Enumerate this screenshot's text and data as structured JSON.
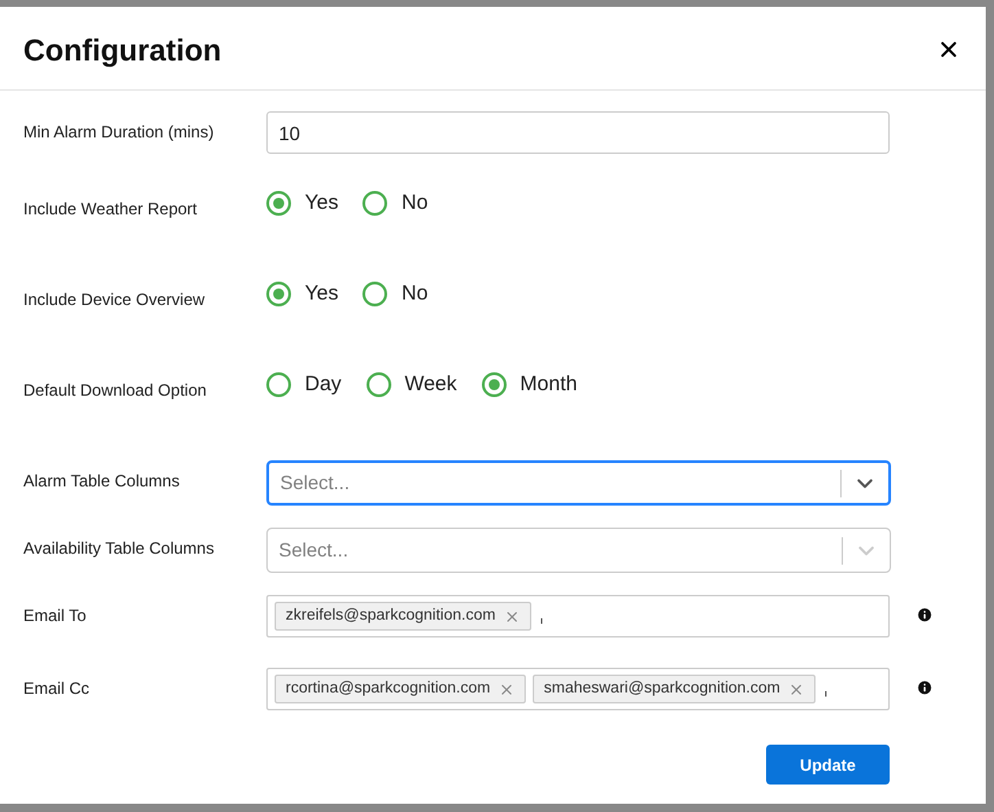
{
  "dialog": {
    "title": "Configuration"
  },
  "fields": [
    {
      "kind": "text",
      "label": "Min Alarm Duration (mins)",
      "value": "10"
    },
    {
      "kind": "radio",
      "label": "Include Weather Report",
      "options": [
        {
          "label": "Yes",
          "selected": true
        },
        {
          "label": "No",
          "selected": false
        }
      ]
    },
    {
      "kind": "radio",
      "label": "Include Device Overview",
      "options": [
        {
          "label": "Yes",
          "selected": true
        },
        {
          "label": "No",
          "selected": false
        }
      ]
    },
    {
      "kind": "radio",
      "label": "Default Download Option",
      "options": [
        {
          "label": "Day",
          "selected": false
        },
        {
          "label": "Week",
          "selected": false
        },
        {
          "label": "Month",
          "selected": true
        }
      ]
    },
    {
      "kind": "select",
      "label": "Alarm Table Columns",
      "placeholder": "Select...",
      "focused": true
    },
    {
      "kind": "select",
      "label": "Availability Table Columns",
      "placeholder": "Select...",
      "focused": false
    },
    {
      "kind": "tags",
      "label": "Email To",
      "tags": [
        "zkreifels@sparkcognition.com"
      ]
    },
    {
      "kind": "tags",
      "label": "Email Cc",
      "tags": [
        "rcortina@sparkcognition.com",
        "smaheswari@sparkcognition.com"
      ]
    }
  ],
  "buttons": [
    "Update"
  ]
}
